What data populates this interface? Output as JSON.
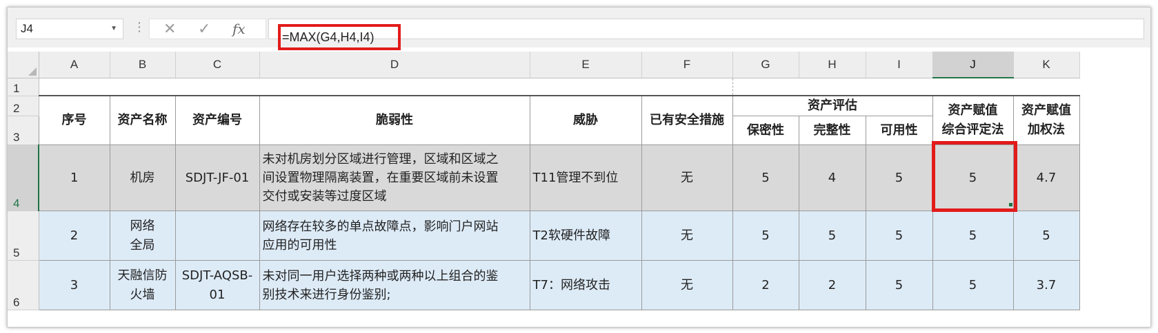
{
  "formula_bar": {
    "name_box": "J4",
    "formula": "=MAX(G4,H4,I4)",
    "icons": [
      "cancel-icon",
      "enter-check-icon",
      "function-fx-icon"
    ]
  },
  "columns": [
    "A",
    "B",
    "C",
    "D",
    "E",
    "F",
    "G",
    "H",
    "I",
    "J",
    "K"
  ],
  "rows": [
    "1",
    "2",
    "3",
    "4",
    "5",
    "6"
  ],
  "selected_column": "J",
  "selected_row": "4",
  "headers": {
    "seq": "序号",
    "asset_name": "资产名称",
    "asset_id": "资产编号",
    "vulnerability": "脆弱性",
    "threat": "威胁",
    "existing_measures": "已有安全措施",
    "asset_assessment": "资产评估",
    "confidentiality": "保密性",
    "integrity": "完整性",
    "availability": "可用性",
    "comprehensive_line1": "资产赋值",
    "comprehensive_line2": "综合评定法",
    "weighted_line1": "资产赋值",
    "weighted_line2": "加权法"
  },
  "data_rows": [
    {
      "seq": "1",
      "asset_name": "机房",
      "asset_name_line2": "",
      "asset_id": "SDJT-JF-01",
      "asset_id_line2": "",
      "vuln_lines": [
        "未对机房划分区域进行管理，区域和区域之",
        "间设置物理隔离装置，在重要区域前未设置",
        "交付或安装等过度区域"
      ],
      "threat": "T11管理不到位",
      "measures": "无",
      "confidentiality": "5",
      "integrity": "4",
      "availability": "5",
      "comprehensive": "5",
      "weighted": "4.7"
    },
    {
      "seq": "2",
      "asset_name": "网络",
      "asset_name_line2": "全局",
      "asset_id": "",
      "asset_id_line2": "",
      "vuln_lines": [
        "网络存在较多的单点故障点，影响门户网站",
        "应用的可用性"
      ],
      "threat": "T2软硬件故障",
      "measures": "无",
      "confidentiality": "5",
      "integrity": "5",
      "availability": "5",
      "comprehensive": "5",
      "weighted": "5"
    },
    {
      "seq": "3",
      "asset_name": "天融信防",
      "asset_name_line2": "火墙",
      "asset_id": "SDJT-AQSB-",
      "asset_id_line2": "01",
      "vuln_lines": [
        "未对同一用户选择两种或两种以上组合的鉴",
        "别技术来进行身份鉴别;"
      ],
      "threat": "T7：网络攻击",
      "measures": "无",
      "confidentiality": "2",
      "integrity": "2",
      "availability": "5",
      "comprehensive": "5",
      "weighted": "3.7"
    }
  ],
  "colors": {
    "row4_fill": "#d9d9d9",
    "row5_6_fill": "#ddebf7",
    "highlight_box": "#e21b1b",
    "selection_accent": "#217346"
  }
}
